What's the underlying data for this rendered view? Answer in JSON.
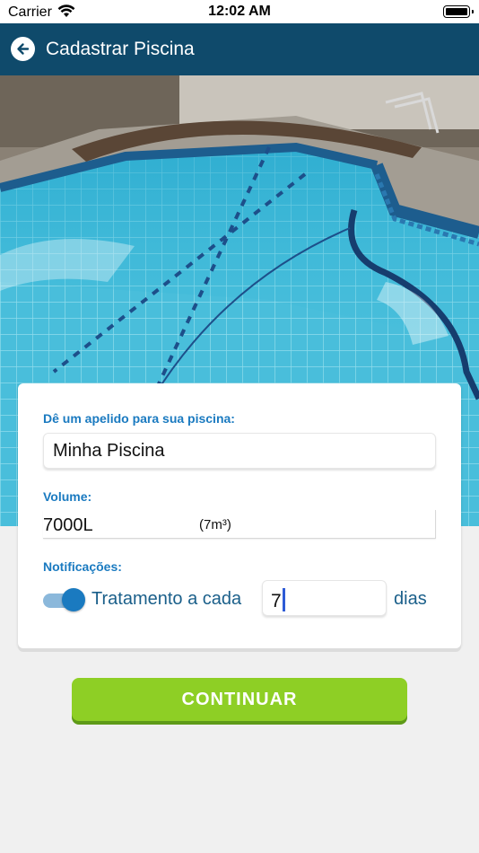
{
  "status_bar": {
    "carrier": "Carrier",
    "time": "12:02 AM"
  },
  "header": {
    "title": "Cadastrar Piscina",
    "back_icon": "arrow-left-icon"
  },
  "photo": {
    "camera_icon": "camera-icon"
  },
  "form": {
    "nickname_label": "Dê um apelido para sua piscina:",
    "nickname_value": "Minha Piscina",
    "volume_label": "Volume:",
    "volume_value": "7000L",
    "volume_m3": "(7m³)",
    "notifications_label": "Notificações:",
    "notifications_enabled": true,
    "treatment_label": "Tratamento a cada",
    "treatment_days_value": "7",
    "days_label": "dias"
  },
  "continue_button": {
    "label": "CONTINUAR"
  },
  "colors": {
    "header_bg": "#0f4a6b",
    "accent_blue": "#1a7ac0",
    "button_green": "#8ecf25"
  }
}
